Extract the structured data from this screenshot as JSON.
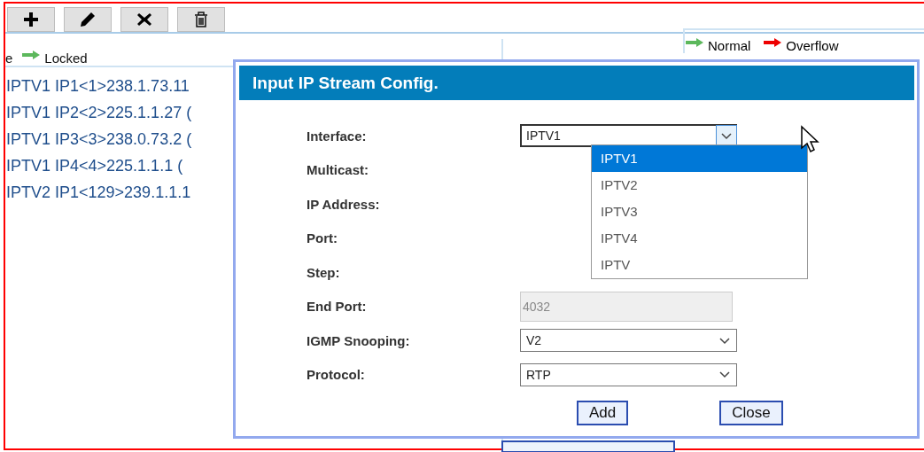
{
  "toolbar": [
    {
      "kind": "add"
    },
    {
      "kind": "edit"
    },
    {
      "kind": "delete"
    },
    {
      "kind": "trash"
    }
  ],
  "left_panel": {
    "legend": [
      {
        "label": "e"
      },
      {
        "label": "Locked",
        "color": "#5cb85c"
      }
    ],
    "rows": [
      "IPTV1 IP1<1>238.1.73.11",
      "IPTV1 IP2<2>225.1.1.27 (",
      "IPTV1 IP3<3>238.0.73.2 (",
      "IPTV1 IP4<4>225.1.1.1 (",
      "IPTV2 IP1<129>239.1.1.1"
    ]
  },
  "right_panel": {
    "legend": [
      {
        "label": "Normal",
        "color": "#5cb85c"
      },
      {
        "label": "Overflow",
        "color": "#ee0000"
      }
    ]
  },
  "dialog": {
    "title": "Input IP Stream Config.",
    "fields": [
      {
        "label": "Interface:",
        "kind": "select",
        "value": "IPTV1",
        "open": true
      },
      {
        "label": "Multicast:",
        "kind": "covered"
      },
      {
        "label": "IP Address:",
        "kind": "covered"
      },
      {
        "label": "Port:",
        "kind": "covered"
      },
      {
        "label": "Step:",
        "kind": "covered"
      },
      {
        "label": "End Port:",
        "kind": "text",
        "value": "4032",
        "disabled": true
      },
      {
        "label": "IGMP Snooping:",
        "kind": "select",
        "value": "V2",
        "open": false
      },
      {
        "label": "Protocol:",
        "kind": "select",
        "value": "RTP",
        "open": false
      }
    ],
    "options": [
      {
        "label": "IPTV1",
        "selected": true
      },
      {
        "label": "IPTV2",
        "selected": false
      },
      {
        "label": "IPTV3",
        "selected": false
      },
      {
        "label": "IPTV4",
        "selected": false
      },
      {
        "label": "IPTV",
        "selected": false
      }
    ],
    "buttons": [
      "Add",
      "Close"
    ]
  }
}
